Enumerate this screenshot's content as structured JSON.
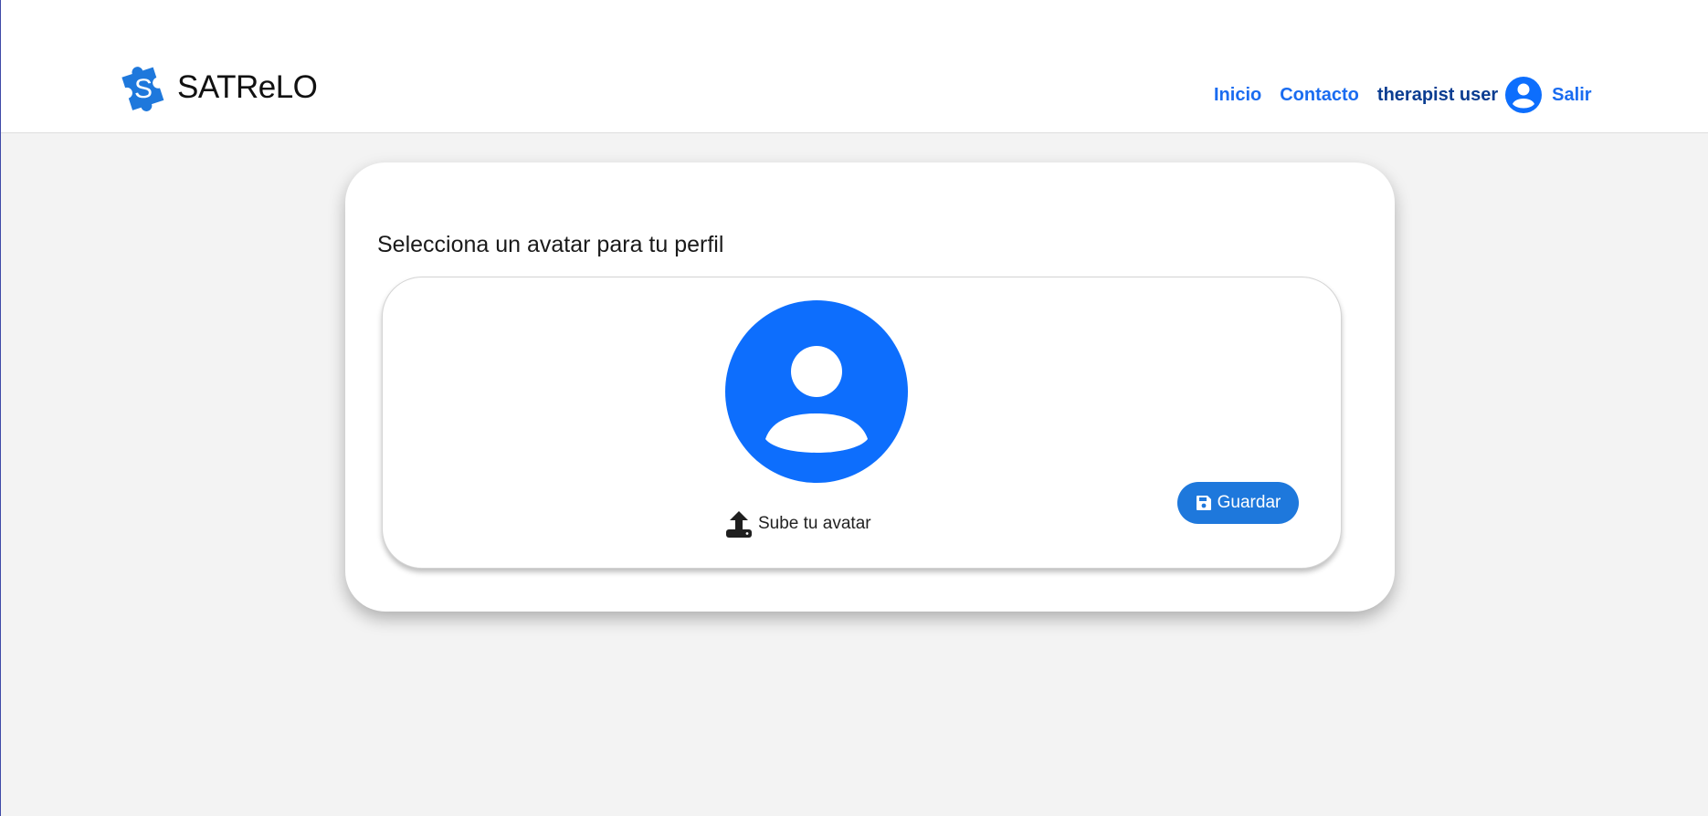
{
  "colors": {
    "accent": "#1a6cf0",
    "user_name": "#0b3d91",
    "avatar_blue": "#0d6efd",
    "button_blue": "#1e78dc",
    "page_background": "#f3f3f3"
  },
  "navbar": {
    "brand_name": "SATReLO",
    "brand_icon": "puzzle-piece-icon",
    "links": {
      "home": "Inicio",
      "contact": "Contacto"
    },
    "user_name": "therapist user",
    "user_icon": "user-circle-icon",
    "logout": "Salir"
  },
  "main": {
    "title": "Selecciona un avatar para tu perfil",
    "avatar_icon": "default-avatar-icon",
    "upload_label": "Sube tu avatar",
    "upload_icon": "upload-icon",
    "save_label": "Guardar",
    "save_icon": "floppy-disk-icon"
  }
}
